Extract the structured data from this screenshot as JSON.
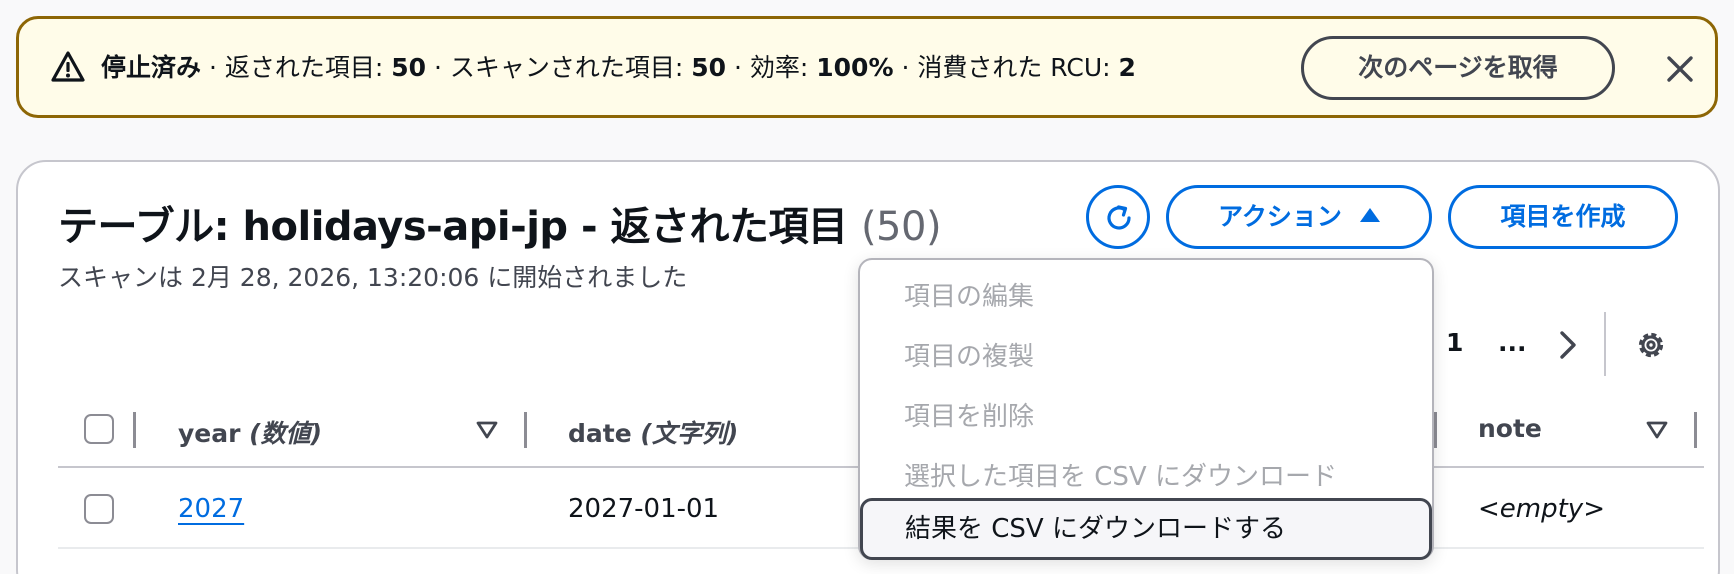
{
  "flash": {
    "status": "停止済み",
    "sep1": " · 返された項目: ",
    "returned": "50",
    "sep2": " · スキャンされた項目: ",
    "scanned": "50",
    "sep3": " · 効率: ",
    "efficiency": "100%",
    "sep4": " · 消費された RCU: ",
    "rcu": "2",
    "next_page_label": "次のページを取得"
  },
  "header": {
    "title": "テーブル: holidays-api-jp - 返された項目",
    "count": "(50)",
    "subtitle": "スキャンは 2月 28, 2026, 13:20:06 に開始されました",
    "actions_label": "アクション",
    "create_label": "項目を作成"
  },
  "pagination": {
    "current_page": "1",
    "ellipsis": "..."
  },
  "menu": {
    "items": [
      {
        "label": "項目の編集",
        "enabled": false
      },
      {
        "label": "項目の複製",
        "enabled": false
      },
      {
        "label": "項目を削除",
        "enabled": false
      },
      {
        "label": "選択した項目を CSV にダウンロード",
        "enabled": false
      },
      {
        "label": "結果を CSV にダウンロードする",
        "enabled": true
      }
    ]
  },
  "table": {
    "columns": [
      {
        "name": "year",
        "type": "(数値)"
      },
      {
        "name": "date",
        "type": "(文字列)"
      },
      {
        "name": "note",
        "type": ""
      }
    ],
    "rows": [
      {
        "year": "2027",
        "date": "2027-01-01",
        "note": "<empty>"
      }
    ]
  },
  "colors": {
    "accent": "#006ce0",
    "warning_border": "#8d6605",
    "warning_bg": "#fffce9"
  }
}
